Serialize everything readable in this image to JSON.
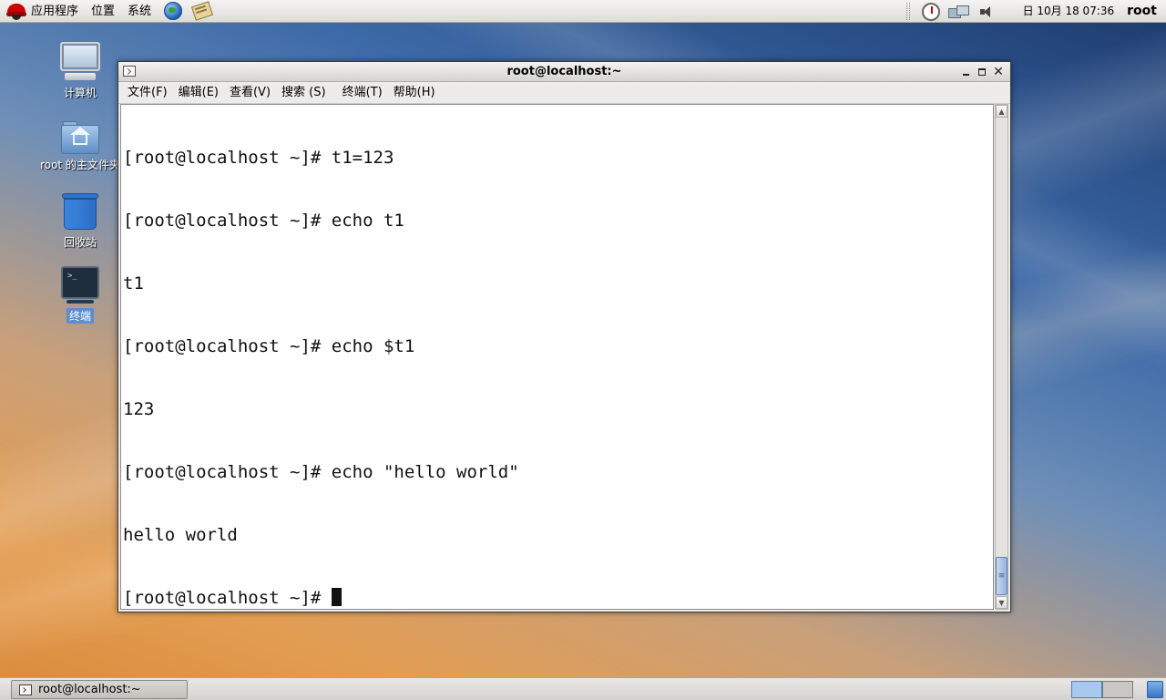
{
  "top_panel": {
    "menus": [
      "应用程序",
      "位置",
      "系统"
    ],
    "clock": "日 10月 18 07:36",
    "username": "root"
  },
  "desktop": {
    "icons": [
      {
        "label": "计算机",
        "icon": "computer-icon"
      },
      {
        "label": "root 的主文件夹",
        "icon": "home-folder-icon"
      },
      {
        "label": "回收站",
        "icon": "trash-icon"
      },
      {
        "label": "终端",
        "icon": "terminal-icon"
      }
    ]
  },
  "window": {
    "title": "root@localhost:~",
    "menubar": [
      "文件(F)",
      "编辑(E)",
      "查看(V)",
      "搜索 (S)",
      "终端(T)",
      "帮助(H)"
    ],
    "terminal_lines": [
      "[root@localhost ~]# t1=123",
      "[root@localhost ~]# echo t1",
      "t1",
      "[root@localhost ~]# echo $t1",
      "123",
      "[root@localhost ~]# echo \"hello world\"",
      "hello world",
      "[root@localhost ~]# "
    ]
  },
  "bottom_panel": {
    "task_label": "root@localhost:~"
  },
  "colors": {
    "selection": "#5b8fd0",
    "workspace_active": "#a9c8ee"
  }
}
